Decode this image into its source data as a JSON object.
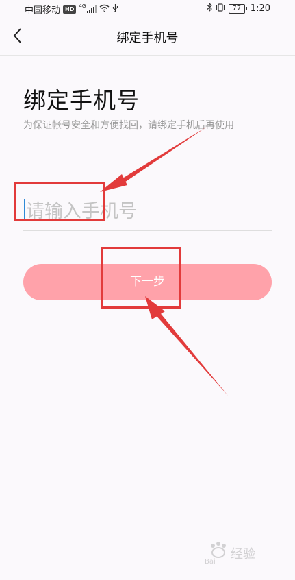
{
  "status_bar": {
    "carrier": "中国移动",
    "hd_badge": "HD",
    "network_type": "4G",
    "battery_level": "77",
    "time": "1:20",
    "icons": [
      "signal-icon",
      "wifi-icon",
      "usb-icon",
      "bluetooth-icon",
      "vibrate-icon",
      "battery-icon"
    ]
  },
  "nav": {
    "title": "绑定手机号",
    "back_icon": "chevron-left-icon"
  },
  "main": {
    "heading": "绑定手机号",
    "subtitle": "为保证帐号安全和方便找回，请绑定手机后再使用",
    "phone_input": {
      "placeholder": "请输入手机号",
      "value": ""
    },
    "next_button_label": "下一步"
  },
  "colors": {
    "background": "#fbf9fc",
    "button": "#ffa2aa",
    "annotation": "#e23b3b",
    "caret": "#2f8ad6"
  },
  "watermark_logo": "Baidu 经验"
}
